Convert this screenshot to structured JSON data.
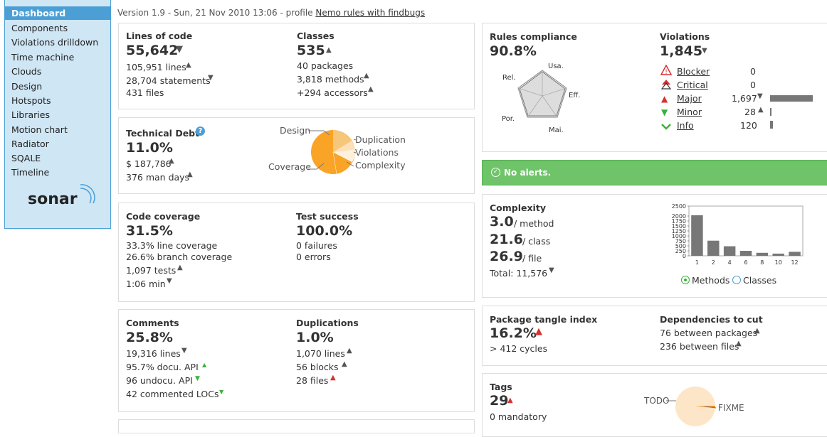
{
  "sidebar": {
    "items": [
      "Dashboard",
      "Components",
      "Violations drilldown",
      "Time machine",
      "Clouds",
      "Design",
      "Hotspots",
      "Libraries",
      "Motion chart",
      "Radiator",
      "SQALE",
      "Timeline"
    ],
    "logo": "sonar"
  },
  "header": {
    "version_text": "Version 1.9 - Sun, 21 Nov 2010 13:06 - profile",
    "profile_link": "Nemo rules with findbugs"
  },
  "loc": {
    "title": "Lines of code",
    "value": "55,642",
    "lines": "105,951 lines",
    "statements": "28,704 statements",
    "files": "431 files"
  },
  "classes": {
    "title": "Classes",
    "value": "535",
    "packages": "40 packages",
    "methods": "3,818 methods",
    "accessors": "+294 accessors"
  },
  "debt": {
    "title": "Technical Debt",
    "value": "11.0%",
    "cost": "$ 187,786",
    "days": "376 man days",
    "pie_labels": {
      "design": "Design",
      "duplication": "Duplication",
      "violations": "Violations",
      "complexity": "Complexity",
      "coverage": "Coverage"
    }
  },
  "coverage": {
    "title": "Code coverage",
    "value": "31.5%",
    "line": "33.3% line coverage",
    "branch": "26.6% branch coverage",
    "tests": "1,097 tests",
    "time": "1:06 min"
  },
  "tests": {
    "title": "Test success",
    "value": "100.0%",
    "failures": "0 failures",
    "errors": "0 errors"
  },
  "comments": {
    "title": "Comments",
    "value": "25.8%",
    "lines": "19,316 lines",
    "docu": "95.7% docu. API",
    "undocu": "96 undocu. API",
    "commented": "42 commented LOCs"
  },
  "dups": {
    "title": "Duplications",
    "value": "1.0%",
    "lines": "1,070 lines",
    "blocks": "56 blocks",
    "files": "28 files"
  },
  "rules": {
    "title": "Rules compliance",
    "value": "90.8%",
    "radar_labels": {
      "usa": "Usa.",
      "eff": "Eff.",
      "mai": "Mai.",
      "por": "Por.",
      "rel": "Rel."
    }
  },
  "violations": {
    "title": "Violations",
    "value": "1,845",
    "rows": [
      {
        "name": "Blocker",
        "count": "0",
        "bar_fraction": 0,
        "color": "#d93030"
      },
      {
        "name": "Critical",
        "count": "0",
        "bar_fraction": 0,
        "color": "#d93030"
      },
      {
        "name": "Major",
        "count": "1,697",
        "bar_fraction": 1.0,
        "color": "#d93030"
      },
      {
        "name": "Minor",
        "count": "28",
        "bar_fraction": 0.017,
        "color": "#3ab23a"
      },
      {
        "name": "Info",
        "count": "120",
        "bar_fraction": 0.071,
        "color": "#3ab23a"
      }
    ]
  },
  "alerts": {
    "text": "No alerts."
  },
  "complexity": {
    "title": "Complexity",
    "method_val": "3.0",
    "method_unit": "/ method",
    "class_val": "21.6",
    "class_unit": "/ class",
    "file_val": "26.9",
    "file_unit": "/ file",
    "total": "Total: 11,576",
    "radio_methods": "Methods",
    "radio_classes": "Classes"
  },
  "chart_data": {
    "type": "bar",
    "categories": [
      "1",
      "2",
      "4",
      "6",
      "8",
      "10",
      "12"
    ],
    "values": [
      2040,
      760,
      480,
      250,
      150,
      110,
      200
    ],
    "ylim": [
      0,
      2500
    ],
    "yticks": [
      "0",
      "250",
      "500",
      "750",
      "1000",
      "1250",
      "1500",
      "1750",
      "2000",
      "2500"
    ],
    "grid": false
  },
  "tangle": {
    "title": "Package tangle index",
    "value": "16.2%",
    "cycles": "> 412 cycles"
  },
  "deps": {
    "title": "Dependencies to cut",
    "packages": "76 between packages",
    "files": "236 between files"
  },
  "tags": {
    "title": "Tags",
    "value": "29",
    "mandatory": "0 mandatory",
    "todo": "TODO",
    "fixme": "FIXME"
  },
  "colors": {
    "sidebar_bg": "#cfe6f5",
    "sidebar_active": "#4b9fd5",
    "alert_green": "#6fc46a",
    "pie_orange": "#f9a427"
  }
}
